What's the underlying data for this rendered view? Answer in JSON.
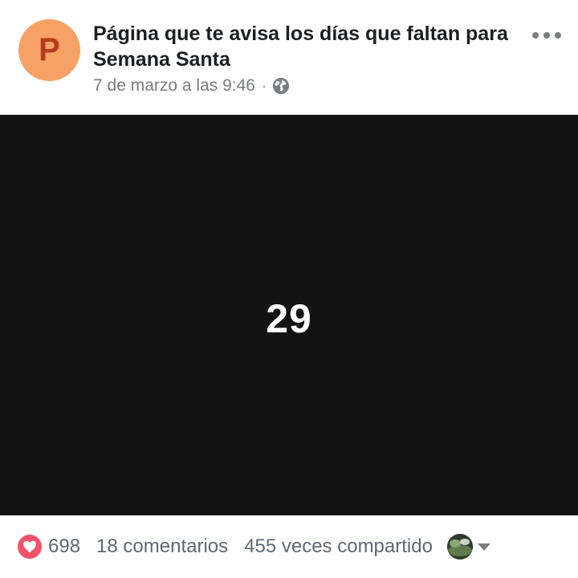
{
  "post": {
    "avatar_letter": "P",
    "page_name": "Página que te avisa los días que faltan para Semana Santa",
    "timestamp": "7 de marzo a las 9:46",
    "separator": "·",
    "privacy_icon": "globe-icon",
    "more_icon": "more-options-icon"
  },
  "image": {
    "text": "29"
  },
  "footer": {
    "reaction_icon": "love-icon",
    "reaction_count": "698",
    "comments": "18 comentarios",
    "shares": "455 veces compartido"
  },
  "colors": {
    "avatar_bg": "#f6a266",
    "avatar_letter": "#b8381b",
    "image_bg": "#131314",
    "love": "#f25268"
  }
}
